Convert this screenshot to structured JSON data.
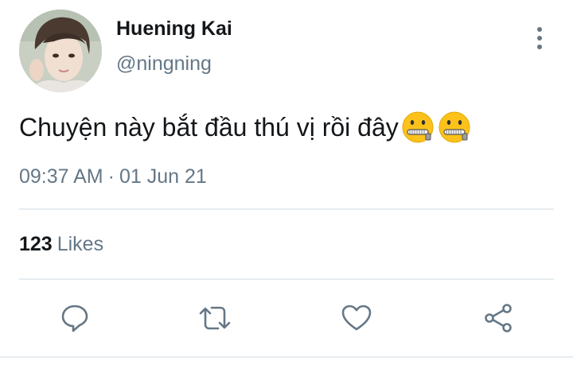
{
  "user": {
    "name": "Huening Kai",
    "handle": "@ningning"
  },
  "tweet": {
    "text": "Chuyện này bắt đầu thú vị rồi đây",
    "emojis": [
      "zipper-mouth-face",
      "zipper-mouth-face"
    ],
    "time": "09:37 AM",
    "separator": "·",
    "date": "01 Jun 21"
  },
  "stats": {
    "likes_count": "123",
    "likes_label": "Likes"
  },
  "icons": {
    "more": "more-vertical-icon",
    "reply": "reply-icon",
    "retweet": "retweet-icon",
    "like": "heart-icon",
    "share": "share-icon"
  },
  "colors": {
    "text": "#14171a",
    "secondary": "#657786",
    "divider": "#e6ecf0",
    "emoji": "#fcc21b"
  }
}
